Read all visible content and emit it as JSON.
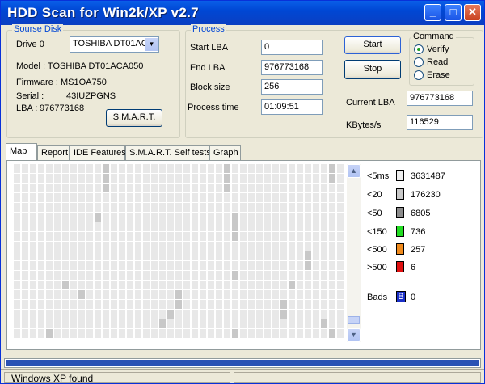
{
  "window": {
    "title": "HDD Scan for Win2k/XP  v2.7"
  },
  "source_disk": {
    "group_label": "Sourse Disk",
    "drive_label": "Drive  0",
    "drive_value": "TOSHIBA DT01AC",
    "model": "Model : TOSHIBA DT01ACA050",
    "firmware": "Firmware : MS1OA750",
    "serial_label": "Serial :",
    "serial_value": "43IUZPGNS",
    "lba_label": "LBA :",
    "lba_value": "976773168",
    "smart_button": "S.M.A.R.T."
  },
  "process": {
    "group_label": "Process",
    "start_lba_label": "Start LBA",
    "start_lba": "0",
    "end_lba_label": "End LBA",
    "end_lba": "976773168",
    "block_size_label": "Block size",
    "block_size": "256",
    "process_time_label": "Process time",
    "process_time": "01:09:51",
    "start_button": "Start",
    "stop_button": "Stop",
    "current_lba_label": "Current LBA",
    "current_lba": "976773168",
    "kbytes_label": "KBytes/s",
    "kbytes": "116529"
  },
  "command": {
    "group_label": "Command",
    "options": [
      {
        "label": "Verify",
        "selected": true
      },
      {
        "label": "Read",
        "selected": false
      },
      {
        "label": "Erase",
        "selected": false
      }
    ]
  },
  "tabs": [
    "Map",
    "Report",
    "IDE Features",
    "S.M.A.R.T. Self tests",
    "Graph"
  ],
  "legend": [
    {
      "label": "<5ms",
      "value": "3631487",
      "color": "#efefef"
    },
    {
      "label": "<20",
      "value": "176230",
      "color": "#c8c8c8"
    },
    {
      "label": "<50",
      "value": "6805",
      "color": "#8c8c8c"
    },
    {
      "label": "<150",
      "value": "736",
      "color": "#22dd22"
    },
    {
      "label": "<500",
      "value": "257",
      "color": "#f08a1c"
    },
    {
      "label": ">500",
      "value": "6",
      "color": "#e01010"
    },
    {
      "label": "Bads",
      "value": "0",
      "color": "#1a2fc8",
      "glyph": "B"
    }
  ],
  "progress": {
    "fraction": 1.0
  },
  "status": {
    "text": "Windows XP found"
  }
}
